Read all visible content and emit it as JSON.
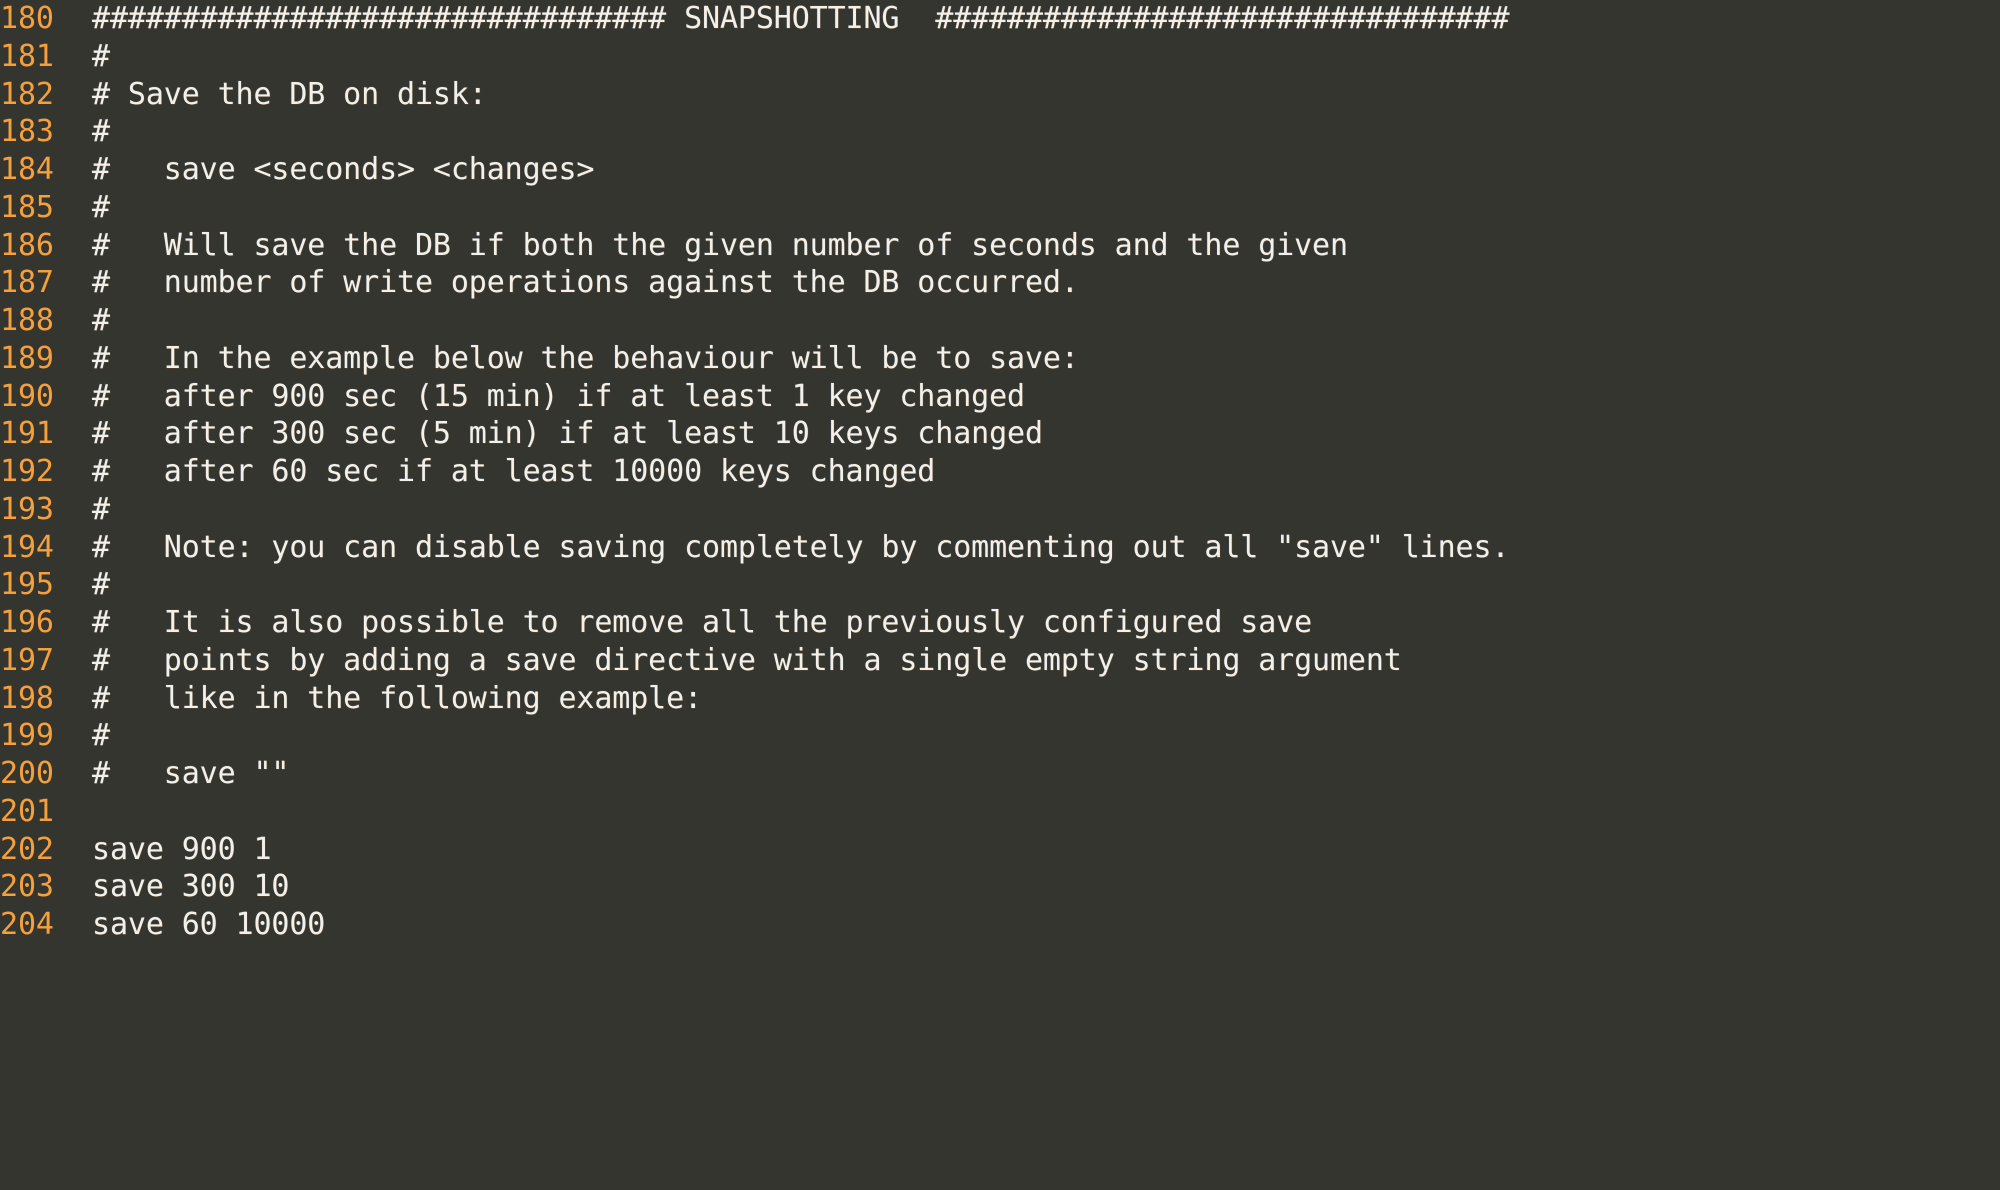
{
  "editor": {
    "name": "text-editor-code-pane",
    "colors": {
      "background": "#353530",
      "line_number": "#F5A03C",
      "code_text": "#F2F0E8"
    },
    "first_line_number": 180,
    "lines": [
      {
        "number": "180",
        "text": "################################ SNAPSHOTTING  ################################"
      },
      {
        "number": "181",
        "text": "#"
      },
      {
        "number": "182",
        "text": "# Save the DB on disk:"
      },
      {
        "number": "183",
        "text": "#"
      },
      {
        "number": "184",
        "text": "#   save <seconds> <changes>"
      },
      {
        "number": "185",
        "text": "#"
      },
      {
        "number": "186",
        "text": "#   Will save the DB if both the given number of seconds and the given"
      },
      {
        "number": "187",
        "text": "#   number of write operations against the DB occurred."
      },
      {
        "number": "188",
        "text": "#"
      },
      {
        "number": "189",
        "text": "#   In the example below the behaviour will be to save:"
      },
      {
        "number": "190",
        "text": "#   after 900 sec (15 min) if at least 1 key changed"
      },
      {
        "number": "191",
        "text": "#   after 300 sec (5 min) if at least 10 keys changed"
      },
      {
        "number": "192",
        "text": "#   after 60 sec if at least 10000 keys changed"
      },
      {
        "number": "193",
        "text": "#"
      },
      {
        "number": "194",
        "text": "#   Note: you can disable saving completely by commenting out all \"save\" lines."
      },
      {
        "number": "195",
        "text": "#"
      },
      {
        "number": "196",
        "text": "#   It is also possible to remove all the previously configured save"
      },
      {
        "number": "197",
        "text": "#   points by adding a save directive with a single empty string argument"
      },
      {
        "number": "198",
        "text": "#   like in the following example:"
      },
      {
        "number": "199",
        "text": "#"
      },
      {
        "number": "200",
        "text": "#   save \"\""
      },
      {
        "number": "201",
        "text": ""
      },
      {
        "number": "202",
        "text": "save 900 1"
      },
      {
        "number": "203",
        "text": "save 300 10"
      },
      {
        "number": "204",
        "text": "save 60 10000"
      }
    ]
  }
}
